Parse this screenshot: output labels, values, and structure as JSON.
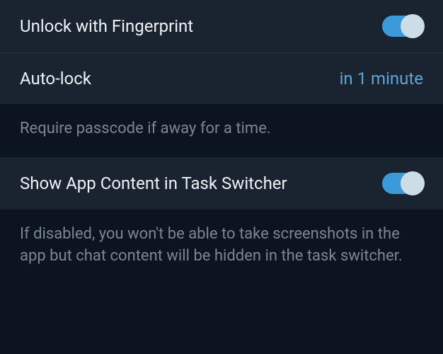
{
  "settings": {
    "fingerprint": {
      "label": "Unlock with Fingerprint",
      "enabled": true
    },
    "autolock": {
      "label": "Auto-lock",
      "value": "in 1 minute",
      "description": "Require passcode if away for a time."
    },
    "taskSwitcher": {
      "label": "Show App Content in Task Switcher",
      "enabled": true,
      "description": "If disabled, you won't be able to take screenshots in the app but chat content will be hidden in the task switcher."
    }
  }
}
